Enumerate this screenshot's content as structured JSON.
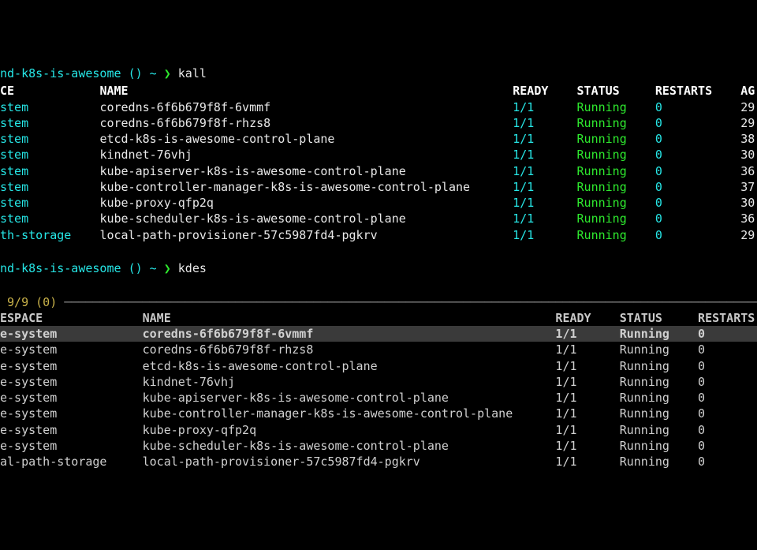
{
  "prompt1": {
    "context": "nd-k8s-is-awesome",
    "branch": "()",
    "tilde": "~",
    "arrow": "❯",
    "cmd": "kall"
  },
  "table1": {
    "headers": {
      "ns": "CE",
      "name": "NAME",
      "ready": "READY",
      "status": "STATUS",
      "restarts": "RESTARTS",
      "age": "AG"
    },
    "rows": [
      {
        "ns": "stem",
        "name": "coredns-6f6b679f8f-6vmmf",
        "ready": "1/1",
        "status": "Running",
        "restarts": "0",
        "age": "29"
      },
      {
        "ns": "stem",
        "name": "coredns-6f6b679f8f-rhzs8",
        "ready": "1/1",
        "status": "Running",
        "restarts": "0",
        "age": "29"
      },
      {
        "ns": "stem",
        "name": "etcd-k8s-is-awesome-control-plane",
        "ready": "1/1",
        "status": "Running",
        "restarts": "0",
        "age": "38"
      },
      {
        "ns": "stem",
        "name": "kindnet-76vhj",
        "ready": "1/1",
        "status": "Running",
        "restarts": "0",
        "age": "30"
      },
      {
        "ns": "stem",
        "name": "kube-apiserver-k8s-is-awesome-control-plane",
        "ready": "1/1",
        "status": "Running",
        "restarts": "0",
        "age": "36"
      },
      {
        "ns": "stem",
        "name": "kube-controller-manager-k8s-is-awesome-control-plane",
        "ready": "1/1",
        "status": "Running",
        "restarts": "0",
        "age": "37"
      },
      {
        "ns": "stem",
        "name": "kube-proxy-qfp2q",
        "ready": "1/1",
        "status": "Running",
        "restarts": "0",
        "age": "30"
      },
      {
        "ns": "stem",
        "name": "kube-scheduler-k8s-is-awesome-control-plane",
        "ready": "1/1",
        "status": "Running",
        "restarts": "0",
        "age": "36"
      },
      {
        "ns": "th-storage",
        "name": "local-path-provisioner-57c5987fd4-pgkrv",
        "ready": "1/1",
        "status": "Running",
        "restarts": "0",
        "age": "29"
      }
    ]
  },
  "prompt2": {
    "context": "nd-k8s-is-awesome",
    "branch": "()",
    "tilde": "~",
    "arrow": "❯",
    "cmd": "kdes"
  },
  "fzf": {
    "count": "9/9 (0)",
    "divider": " ───────────────────────────────────────────────────────────────────────────────────────────────────",
    "headers": {
      "ns": "ESPACE",
      "name": "NAME",
      "ready": "READY",
      "status": "STATUS",
      "restarts": "RESTARTS"
    },
    "rows": [
      {
        "ns": "e-system",
        "name": "coredns-6f6b679f8f-6vmmf",
        "ready": "1/1",
        "status": "Running",
        "restarts": "0",
        "selected": true
      },
      {
        "ns": "e-system",
        "name": "coredns-6f6b679f8f-rhzs8",
        "ready": "1/1",
        "status": "Running",
        "restarts": "0"
      },
      {
        "ns": "e-system",
        "name": "etcd-k8s-is-awesome-control-plane",
        "ready": "1/1",
        "status": "Running",
        "restarts": "0"
      },
      {
        "ns": "e-system",
        "name": "kindnet-76vhj",
        "ready": "1/1",
        "status": "Running",
        "restarts": "0"
      },
      {
        "ns": "e-system",
        "name": "kube-apiserver-k8s-is-awesome-control-plane",
        "ready": "1/1",
        "status": "Running",
        "restarts": "0"
      },
      {
        "ns": "e-system",
        "name": "kube-controller-manager-k8s-is-awesome-control-plane",
        "ready": "1/1",
        "status": "Running",
        "restarts": "0"
      },
      {
        "ns": "e-system",
        "name": "kube-proxy-qfp2q",
        "ready": "1/1",
        "status": "Running",
        "restarts": "0"
      },
      {
        "ns": "e-system",
        "name": "kube-scheduler-k8s-is-awesome-control-plane",
        "ready": "1/1",
        "status": "Running",
        "restarts": "0"
      },
      {
        "ns": "al-path-storage",
        "name": "local-path-provisioner-57c5987fd4-pgkrv",
        "ready": "1/1",
        "status": "Running",
        "restarts": "0"
      }
    ]
  }
}
